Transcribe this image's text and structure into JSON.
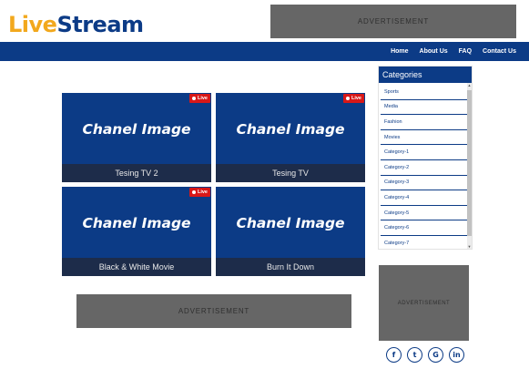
{
  "logo": {
    "part1": "Live",
    "part2": "Stream"
  },
  "ads": {
    "top": "ADVERTISEMENT",
    "bottom": "ADVERTISEMENT",
    "sidebar": "ADVERTISEMENT"
  },
  "nav": {
    "items": [
      "Home",
      "About Us",
      "FAQ",
      "Contact Us"
    ]
  },
  "cards": [
    {
      "image_text": "Chanel Image",
      "title": "Tesing TV 2",
      "live": "Live"
    },
    {
      "image_text": "Chanel Image",
      "title": "Tesing TV",
      "live": "Live"
    },
    {
      "image_text": "Chanel Image",
      "title": "Black & White Movie",
      "live": "Live"
    },
    {
      "image_text": "Chanel Image",
      "title": "Burn It Down"
    }
  ],
  "categories": {
    "title": "Categories",
    "items": [
      "Sports",
      "Media",
      "Fashion",
      "Movies",
      "Category-1",
      "Category-2",
      "Category-3",
      "Category-4",
      "Category-5",
      "Category-6",
      "Category-7"
    ]
  },
  "social": [
    {
      "icon": "facebook-icon",
      "glyph": "f"
    },
    {
      "icon": "twitter-icon",
      "glyph": "t"
    },
    {
      "icon": "google-icon",
      "glyph": "G"
    },
    {
      "icon": "linkedin-icon",
      "glyph": "in"
    }
  ],
  "colors": {
    "brand_blue": "#0c3b86",
    "brand_orange": "#f2a81d",
    "live_red": "#d81818",
    "ad_gray": "#666666"
  }
}
